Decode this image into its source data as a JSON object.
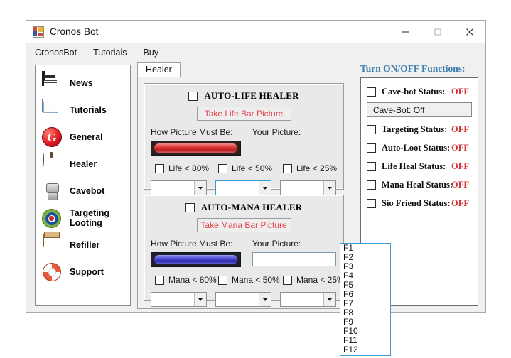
{
  "window": {
    "title": "Cronos Bot",
    "app_icon": "app-icon",
    "controls": {
      "minimize": "minimize-icon",
      "maximize": "maximize-icon",
      "close": "close-icon"
    }
  },
  "menubar": {
    "items": [
      {
        "label": "CronosBot"
      },
      {
        "label": "Tutorials"
      },
      {
        "label": "Buy"
      }
    ]
  },
  "sidebar": {
    "items": [
      {
        "label": "News",
        "icon": "news-icon"
      },
      {
        "label": "Tutorials",
        "icon": "tutorials-icon"
      },
      {
        "label": "General",
        "icon": "general-icon"
      },
      {
        "label": "Healer",
        "icon": "healer-icon"
      },
      {
        "label": "Cavebot",
        "icon": "cavebot-icon"
      },
      {
        "label": "Targeting\nLooting",
        "icon": "targeting-icon"
      },
      {
        "label": "Refiller",
        "icon": "refiller-icon"
      },
      {
        "label": "Support",
        "icon": "support-icon"
      }
    ]
  },
  "tabs": {
    "active": "Healer",
    "items": [
      {
        "label": "Healer"
      }
    ]
  },
  "life_group": {
    "title": "AUTO-LIFE HEALER",
    "enabled": false,
    "take_picture_button": "Take Life Bar Picture",
    "label_must_be": "How Picture Must Be:",
    "label_your_picture": "Your Picture:",
    "bar_color": "#e23a3a",
    "thresholds": [
      {
        "label": "Life < 80%",
        "checked": false,
        "key": ""
      },
      {
        "label": "Life < 50%",
        "checked": false,
        "key": ""
      },
      {
        "label": "Life < 25%",
        "checked": false,
        "key": ""
      }
    ]
  },
  "mana_group": {
    "title": "AUTO-MANA HEALER",
    "enabled": false,
    "take_picture_button": "Take Mana Bar Picture",
    "label_must_be": "How Picture Must Be:",
    "label_your_picture": "Your Picture:",
    "bar_color": "#4b49d6",
    "thresholds": [
      {
        "label": "Mana < 80%",
        "checked": false,
        "key": ""
      },
      {
        "label": "Mana < 50%",
        "checked": false,
        "key": ""
      },
      {
        "label": "Mana < 25%",
        "checked": false,
        "key": ""
      }
    ]
  },
  "dropdown": {
    "open": true,
    "options": [
      "F1",
      "F2",
      "F3",
      "F4",
      "F5",
      "F6",
      "F7",
      "F8",
      "F9",
      "F10",
      "F11",
      "F12"
    ]
  },
  "functions_panel": {
    "title": "Turn ON/OFF Functions:",
    "title_color": "#3c7fb1",
    "off_color": "#d0353b",
    "cavebot_status_text": "Cave-Bot: Off",
    "rows": [
      {
        "label": "Cave-bot Status:",
        "value": "OFF",
        "checked": false
      },
      {
        "label": "Targeting Status:",
        "value": "OFF",
        "checked": false
      },
      {
        "label": "Auto-Loot Status:",
        "value": "OFF",
        "checked": false
      },
      {
        "label": "Life Heal Status:",
        "value": "OFF",
        "checked": false
      },
      {
        "label": "Mana Heal Status:",
        "value": "OFF",
        "checked": false
      },
      {
        "label": "Sio Friend Status:",
        "value": "OFF",
        "checked": false
      }
    ]
  }
}
